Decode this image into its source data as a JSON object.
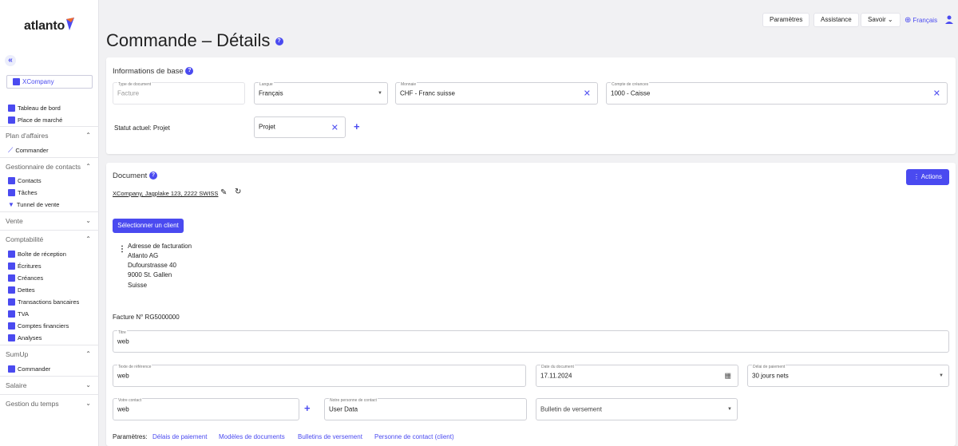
{
  "app": {
    "logo_text": "atlanto"
  },
  "colors": {
    "accent": "#4a4af0",
    "background": "#f1f1f3"
  },
  "sidebar": {
    "company": "XCompany",
    "items": [
      {
        "label": "Tableau de bord",
        "icon": "dashboard-icon"
      },
      {
        "label": "Place de marché",
        "icon": "store-icon"
      }
    ],
    "sections": [
      {
        "label": "Plan d'affaires",
        "expanded": true,
        "items": [
          {
            "label": "Commander",
            "icon": "trend-icon"
          }
        ]
      },
      {
        "label": "Gestionnaire de contacts",
        "expanded": true,
        "items": [
          {
            "label": "Contacts",
            "icon": "contacts-icon"
          },
          {
            "label": "Tâches",
            "icon": "tasks-icon"
          },
          {
            "label": "Tunnel de vente",
            "icon": "funnel-icon"
          }
        ]
      },
      {
        "label": "Vente",
        "expanded": false,
        "items": []
      },
      {
        "label": "Comptabilité",
        "expanded": true,
        "items": [
          {
            "label": "Boîte de réception",
            "icon": "inbox-icon"
          },
          {
            "label": "Écritures",
            "icon": "entries-icon"
          },
          {
            "label": "Créances",
            "icon": "receivables-icon"
          },
          {
            "label": "Dettes",
            "icon": "debts-icon"
          },
          {
            "label": "Transactions bancaires",
            "icon": "bank-icon"
          },
          {
            "label": "TVA",
            "icon": "vat-icon"
          },
          {
            "label": "Comptes financiers",
            "icon": "accounts-icon"
          },
          {
            "label": "Analyses",
            "icon": "analysis-icon"
          }
        ]
      },
      {
        "label": "SumUp",
        "expanded": true,
        "items": [
          {
            "label": "Commander",
            "icon": "briefcase-icon"
          }
        ]
      },
      {
        "label": "Salaire",
        "expanded": false,
        "items": []
      },
      {
        "label": "Gestion du temps",
        "expanded": false,
        "items": []
      }
    ]
  },
  "header": {
    "title": "Commande – Détails",
    "buttons": {
      "params": "Paramètres",
      "help": "Assistance",
      "know": "Savoir"
    },
    "language": "Français"
  },
  "basic": {
    "title": "Informations de base",
    "doc_type": {
      "label": "Type de document",
      "value": "Facture"
    },
    "language": {
      "label": "Langue",
      "value": "Français"
    },
    "currency": {
      "label": "Monnaie",
      "value": "CHF - Franc suisse"
    },
    "receivable": {
      "label": "Compte de créances",
      "value": "1000 - Caisse"
    },
    "status_label": "Statut actuel: Projet",
    "status_chip": "Projet"
  },
  "document": {
    "title": "Document",
    "actions": "Actions",
    "sender": "XCompany, Jagplake 123, 2222 SWISS",
    "select_client": "Sélectionner un client",
    "billing": {
      "heading": "Adresse de facturation",
      "lines": [
        "Atlanto AG",
        "Dufourstrasse 40",
        "9000 St. Gallen",
        "Suisse"
      ]
    },
    "invoice_no": "Facture N° RG5000000",
    "title_field": {
      "label": "Titre",
      "value": "web"
    },
    "reference": {
      "label": "Texte de référence",
      "value": "web"
    },
    "doc_date": {
      "label": "Date du document",
      "value": "17.11.2024"
    },
    "payment_term": {
      "label": "Délai de paiement",
      "value": "30 jours nets"
    },
    "your_contact": {
      "label": "Votre contact",
      "value": "web"
    },
    "our_contact": {
      "label": "Notre personne de contact",
      "value": "User Data"
    },
    "payment_slip": {
      "placeholder": "Bulletin de versement"
    },
    "params_label": "Paramètres:",
    "param_links": [
      "Délais de paiement",
      "Modèles de documents",
      "Bulletins de versement",
      "Personne de contact (client)"
    ]
  }
}
